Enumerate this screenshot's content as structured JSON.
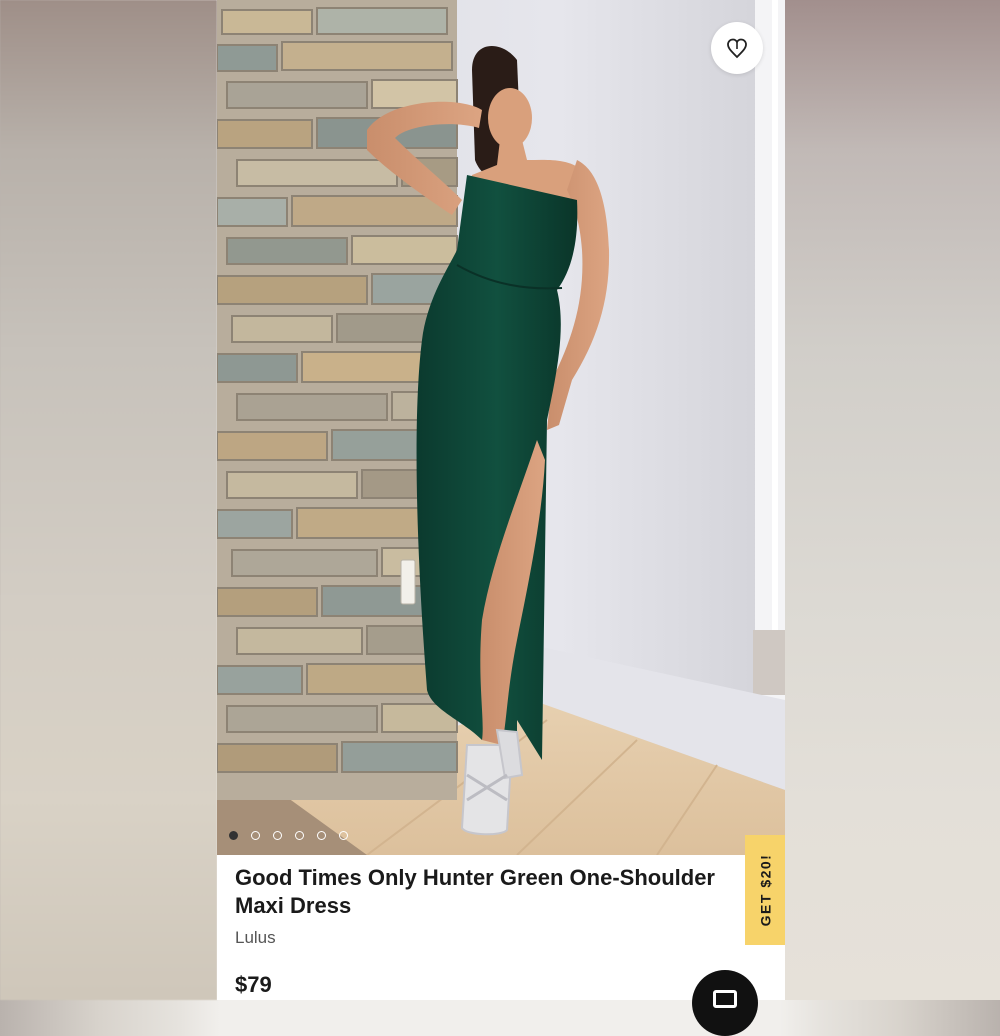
{
  "product": {
    "title_line1": "Good Times Only Hunter Green One-Shoulder",
    "title_line2": "Maxi Dress",
    "brand": "Lulus",
    "price": "$79"
  },
  "image": {
    "alt": "Model wearing a hunter green one-shoulder maxi dress with side slit",
    "dress_color": "#0f4a3a"
  },
  "carousel": {
    "total": 6,
    "active": 1
  },
  "favorite": {
    "icon": "heart-icon"
  },
  "promo": {
    "label": "GET $20!",
    "color": "#f7d36a"
  },
  "chat": {
    "icon": "chat-icon"
  }
}
